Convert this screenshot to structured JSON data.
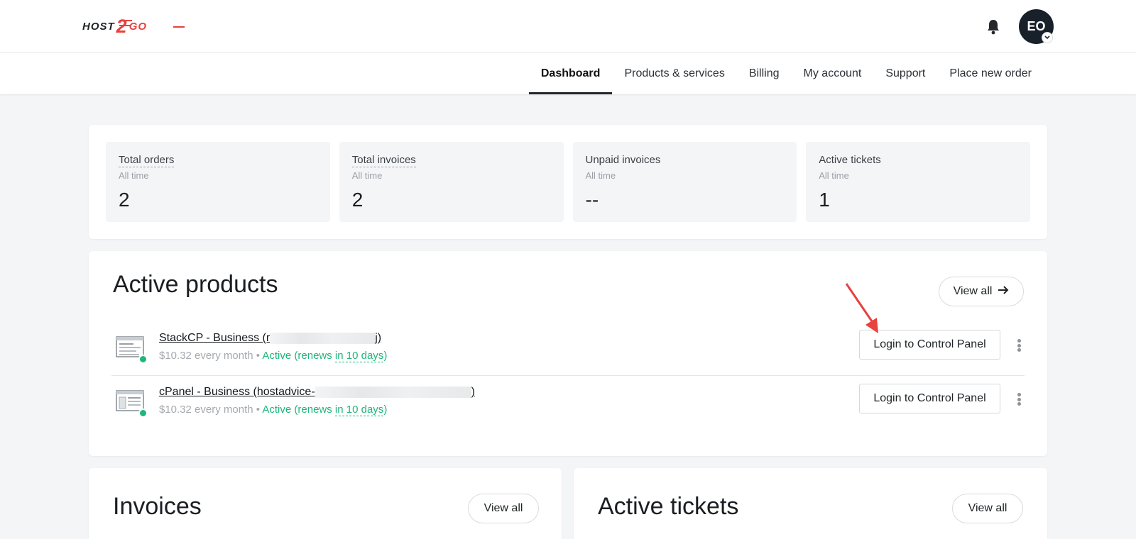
{
  "header": {
    "logo": {
      "part1": "HOST",
      "part2": "2",
      "part3": "GO"
    },
    "avatar_initials": "EO"
  },
  "nav": {
    "items": [
      "Dashboard",
      "Products & services",
      "Billing",
      "My account",
      "Support",
      "Place new order"
    ],
    "active": "Dashboard"
  },
  "stats": [
    {
      "label": "Total orders",
      "period": "All time",
      "value": "2"
    },
    {
      "label": "Total invoices",
      "period": "All time",
      "value": "2"
    },
    {
      "label": "Unpaid invoices",
      "period": "All time",
      "value": "--"
    },
    {
      "label": "Active tickets",
      "period": "All time",
      "value": "1"
    }
  ],
  "active_products": {
    "title": "Active products",
    "view_all_label": "View all",
    "items": [
      {
        "name_prefix": "StackCP - Business (r",
        "name_suffix": "j)",
        "price": "$10.32 every month",
        "separator": "•",
        "status_prefix": "Active (renews ",
        "status_renew": "in 10 days",
        "status_suffix": ")",
        "login_label": "Login to Control Panel"
      },
      {
        "name_prefix": "cPanel - Business (hostadvice-",
        "name_suffix": ")",
        "price": "$10.32 every month",
        "separator": "•",
        "status_prefix": "Active (renews ",
        "status_renew": "in 10 days",
        "status_suffix": ")",
        "login_label": "Login to Control Panel"
      }
    ]
  },
  "invoices": {
    "title": "Invoices",
    "view_all_label": "View all"
  },
  "active_tickets": {
    "title": "Active tickets",
    "view_all_label": "View all"
  },
  "colors": {
    "accent_red": "#e8413e",
    "status_green": "#1fb67a",
    "avatar_bg": "#18202a"
  },
  "icons": {
    "notifications": "bell-icon",
    "view_all": "arrow-right-icon",
    "row_menu": "kebab-icon",
    "product": "control-panel-icon"
  }
}
